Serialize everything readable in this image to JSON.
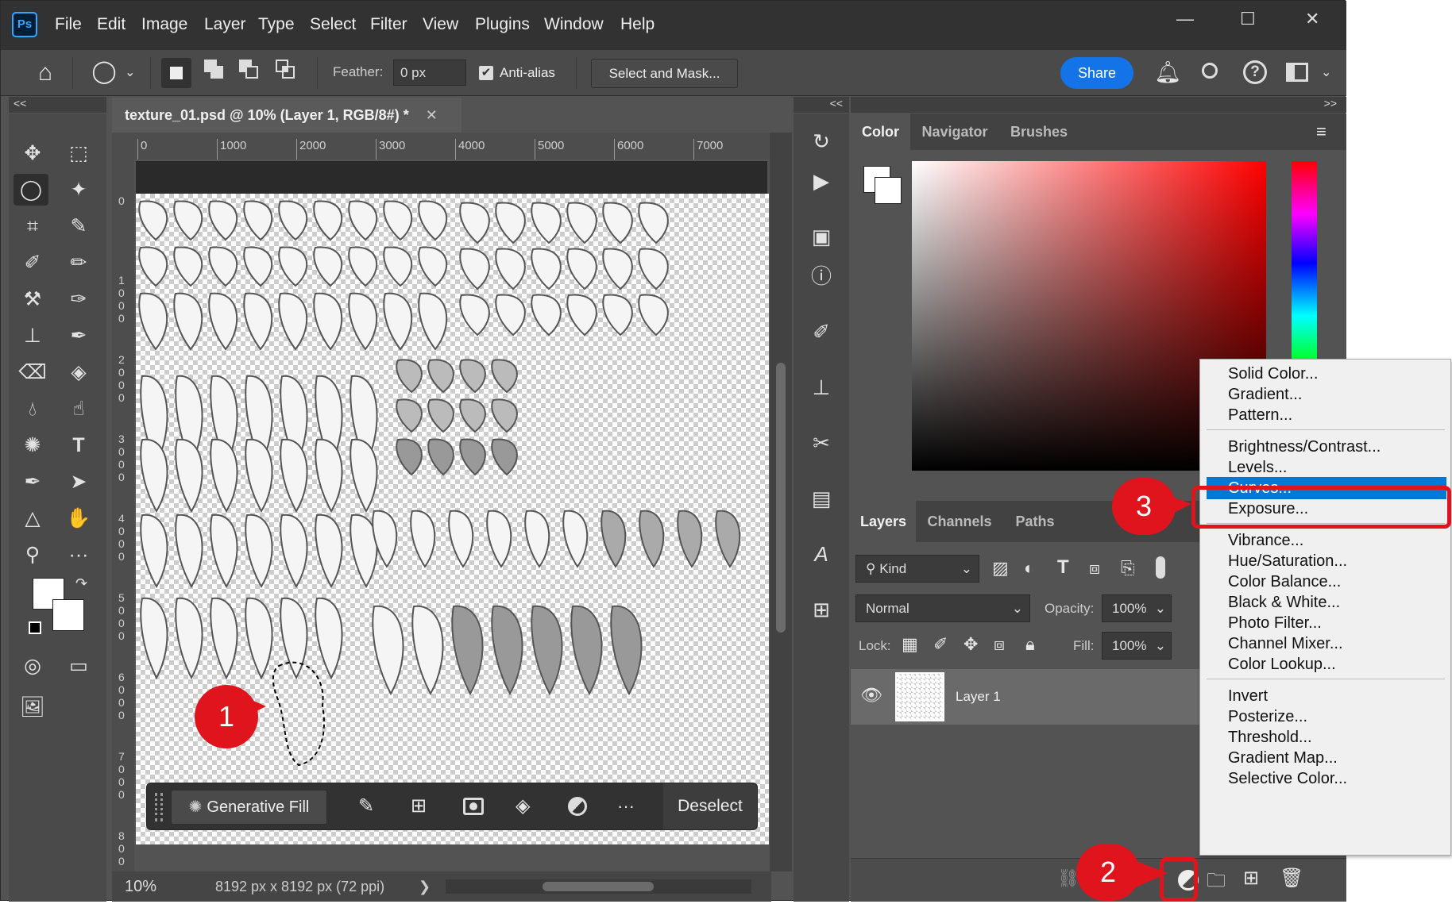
{
  "app": {
    "name": "Ps",
    "window_controls": [
      "—",
      "☐",
      "✕"
    ]
  },
  "menubar": [
    "File",
    "Edit",
    "Image",
    "Layer",
    "Type",
    "Select",
    "Filter",
    "View",
    "Plugins",
    "Window",
    "Help"
  ],
  "options": {
    "feather_label": "Feather:",
    "feather_value": "0 px",
    "antialias_label": "Anti-alias",
    "select_mask": "Select and Mask...",
    "share": "Share"
  },
  "collapse": {
    "left": "<<",
    "mid": "<<",
    "right": ">>"
  },
  "doc": {
    "tab_title": "texture_01.psd @ 10% (Layer 1, RGB/8#) *",
    "close": "✕"
  },
  "ruler": {
    "h_ticks": [
      "0",
      "1000",
      "2000",
      "3000",
      "4000",
      "5000",
      "6000",
      "7000"
    ],
    "v_ticks": [
      "0",
      "1\n0\n0\n0",
      "2\n0\n0\n0",
      "3\n0\n0\n0",
      "4\n0\n0\n0",
      "5\n0\n0\n0",
      "6\n0\n0\n0",
      "7\n0\n0\n0",
      "8\n0\n0"
    ]
  },
  "contextbar": {
    "generative_fill": "Generative Fill",
    "more": "···",
    "deselect": "Deselect"
  },
  "status": {
    "zoom": "10%",
    "doc_info": "8192 px x 8192 px (72 ppi)",
    "arrow": "❯"
  },
  "color_panel": {
    "tabs": [
      "Color",
      "Navigator",
      "Brushes"
    ]
  },
  "layers_panel": {
    "tabs": [
      "Layers",
      "Channels",
      "Paths"
    ],
    "kind": "Kind",
    "blend_mode": "Normal",
    "opacity_label": "Opacity:",
    "opacity_value": "100%",
    "lock_label": "Lock:",
    "fill_label": "Fill:",
    "fill_value": "100%",
    "layer_name": "Layer 1"
  },
  "adjust_menu": {
    "groups": [
      [
        "Solid Color...",
        "Gradient...",
        "Pattern..."
      ],
      [
        "Brightness/Contrast...",
        "Levels...",
        "Curves...",
        "Exposure..."
      ],
      [
        "Vibrance...",
        "Hue/Saturation...",
        "Color Balance...",
        "Black & White...",
        "Photo Filter...",
        "Channel Mixer...",
        "Color Lookup..."
      ],
      [
        "Invert",
        "Posterize...",
        "Threshold...",
        "Gradient Map...",
        "Selective Color..."
      ]
    ],
    "highlighted": "Curves..."
  },
  "callouts": [
    "1",
    "2",
    "3"
  ],
  "colors": {
    "accent": "#1473e6",
    "callout": "#e0141d",
    "menu_highlight": "#0078d7"
  }
}
